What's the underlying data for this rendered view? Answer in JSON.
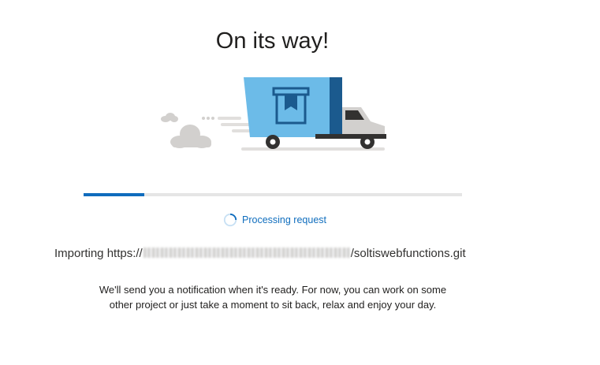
{
  "header": {
    "title": "On its way!"
  },
  "illustration": {
    "name": "delivery-truck-illustration",
    "colors": {
      "cargo": "#6cbbe8",
      "cargo_dark": "#1b5a8e",
      "cab": "#d2d0ce",
      "wheel": "#323130",
      "cloud": "#d2d0ce"
    }
  },
  "progress": {
    "value_fraction": 0.16,
    "color": "#0f6cbd",
    "track_color": "#e5e5e5"
  },
  "status": {
    "icon": "spinner-icon",
    "text": "Processing request"
  },
  "import": {
    "prefix": "Importing https://",
    "suffix": "/soltiswebfunctions.git"
  },
  "message": {
    "line1": "We'll send you a notification when it's ready. For now, you can work on some",
    "line2": "other project or just take a moment to sit back, relax and enjoy your day."
  }
}
